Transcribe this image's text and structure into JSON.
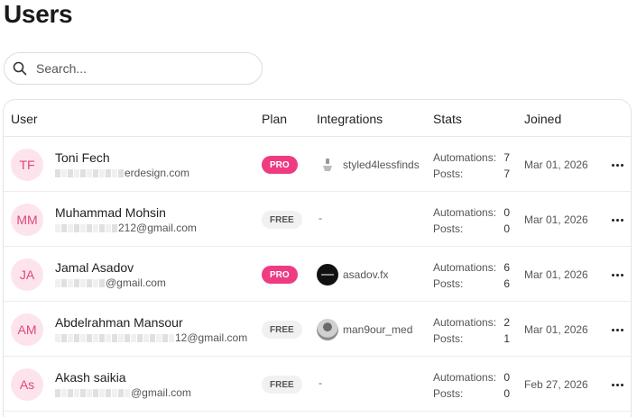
{
  "page": {
    "title": "Users"
  },
  "search": {
    "placeholder": "Search...",
    "value": ""
  },
  "table": {
    "columns": {
      "user": "User",
      "plan": "Plan",
      "integrations": "Integrations",
      "stats": "Stats",
      "joined": "Joined"
    },
    "stats_labels": {
      "automations": "Automations:",
      "posts": "Posts:"
    },
    "rows": [
      {
        "initials": "TF",
        "name": "Toni Fech",
        "email_visible": "erdesign.com",
        "plan": "PRO",
        "integration": "styled4lessfinds",
        "integration_icon": "brand-logo-icon",
        "automations": "7",
        "posts": "7",
        "joined": "Mar 01, 2026"
      },
      {
        "initials": "MM",
        "name": "Muhammad Mohsin",
        "email_visible": "212@gmail.com",
        "plan": "FREE",
        "integration": "-",
        "integration_icon": "",
        "automations": "0",
        "posts": "0",
        "joined": "Mar 01, 2026"
      },
      {
        "initials": "JA",
        "name": "Jamal Asadov",
        "email_visible": "@gmail.com",
        "plan": "PRO",
        "integration": "asadov.fx",
        "integration_icon": "dark-logo-icon",
        "automations": "6",
        "posts": "6",
        "joined": "Mar 01, 2026"
      },
      {
        "initials": "AM",
        "name": "Abdelrahman Mansour",
        "email_visible": "12@gmail.com",
        "plan": "FREE",
        "integration": "man9our_med",
        "integration_icon": "profile-photo-icon",
        "automations": "2",
        "posts": "1",
        "joined": "Mar 01, 2026"
      },
      {
        "initials": "As",
        "name": "Akash saikia",
        "email_visible": "@gmail.com",
        "plan": "FREE",
        "integration": "-",
        "integration_icon": "",
        "automations": "0",
        "posts": "0",
        "joined": "Feb 27, 2026"
      }
    ]
  },
  "colors": {
    "pro_badge": "#ee3b82",
    "free_badge": "#f1f1f1",
    "avatar_bg": "#fde4ec",
    "avatar_text": "#e0467c"
  }
}
